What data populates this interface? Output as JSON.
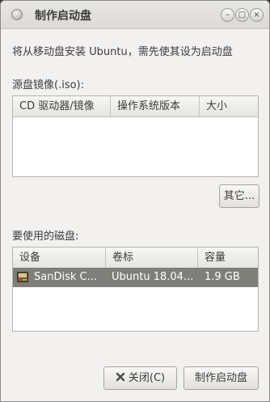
{
  "window": {
    "title": "制作启动盘"
  },
  "intro_text": "将从移动盘安装 Ubuntu，需先使其设为启动盘",
  "source": {
    "label": "源盘镜像(.iso):",
    "columns": [
      "CD 驱动器/镜像",
      "操作系统版本",
      "大小"
    ],
    "other_button": "其它..."
  },
  "target": {
    "label": "要使用的磁盘:",
    "columns": [
      "设备",
      "卷标",
      "容量"
    ],
    "rows": [
      {
        "device": "SanDisk C...",
        "label": "Ubuntu 18.04...",
        "capacity": "1.9 GB",
        "icon": "drive-icon"
      }
    ]
  },
  "buttons": {
    "close_label": "关闭(C)",
    "make_label": "制作启动盘"
  },
  "icons": {
    "close": "x-icon",
    "window_close": "close-icon",
    "window_min": "minimize-icon",
    "window_max": "maximize-icon"
  }
}
